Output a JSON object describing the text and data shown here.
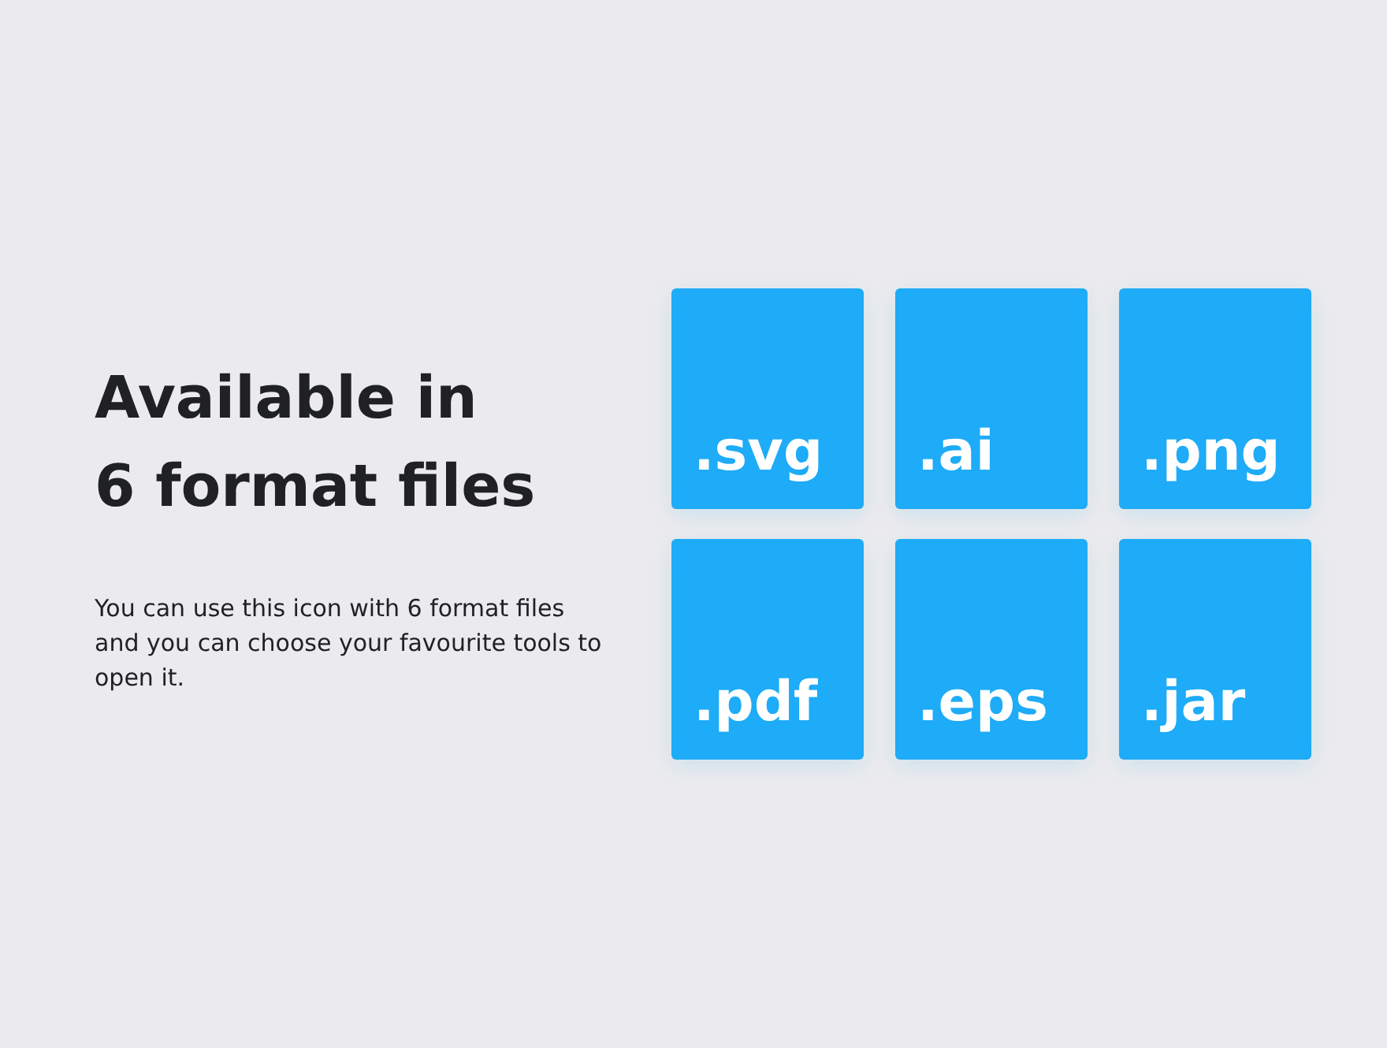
{
  "heading": [
    "Available in",
    "6 format files"
  ],
  "description": "You can use this icon with 6 format files and you can choose your favourite tools to open it.",
  "formats": [
    {
      "label": ".svg"
    },
    {
      "label": ".ai"
    },
    {
      "label": ".png"
    },
    {
      "label": ".pdf"
    },
    {
      "label": ".eps"
    },
    {
      "label": ".jar"
    }
  ]
}
